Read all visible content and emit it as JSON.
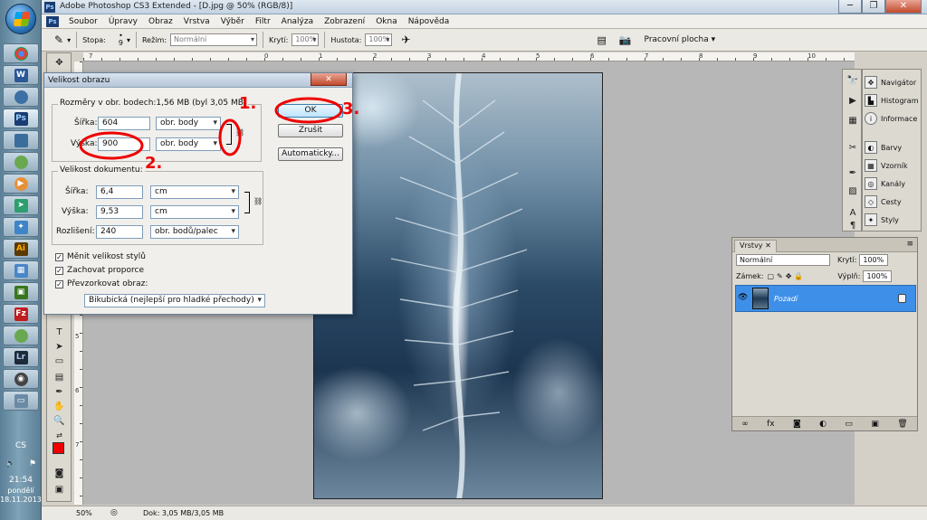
{
  "taskbar": {
    "language": "CS",
    "time": "21:54",
    "day": "pondělí",
    "date": "18.11.2013"
  },
  "window": {
    "app_logo": "Ps",
    "title": "Adobe Photoshop CS3 Extended - [D.jpg @ 50% (RGB/8)]",
    "controls": {
      "minimize": "─",
      "maximize": "❐",
      "close": "✕"
    }
  },
  "menu": [
    "Soubor",
    "Úpravy",
    "Obraz",
    "Vrstva",
    "Výběr",
    "Filtr",
    "Analýza",
    "Zobrazení",
    "Okna",
    "Nápověda"
  ],
  "options": {
    "brush_label": "Stopa:",
    "brush_size": "9",
    "mode_label": "Režim:",
    "mode_value": "Normální",
    "opacity_label": "Krytí:",
    "opacity_value": "100%",
    "flow_label": "Hustota:",
    "flow_value": "100%",
    "workspace": "Pracovní plocha ▾"
  },
  "rulers": {
    "top": [
      "7",
      "0",
      "1",
      "2",
      "3",
      "4",
      "5",
      "6",
      "7",
      "8",
      "9",
      "10",
      "11",
      "12",
      "13"
    ],
    "left": [
      "1",
      "2",
      "3",
      "4",
      "5",
      "6",
      "7",
      "8",
      "9",
      "10",
      "11",
      "12"
    ]
  },
  "dialog": {
    "title": "Velikost obrazu",
    "close": "✕",
    "pixel_dims": "Rozměry v obr. bodech:1,56 MB (byl 3,05 MB)",
    "width_label": "Šířka:",
    "width_value": "604",
    "width_unit": "obr. body",
    "height_label": "Výška:",
    "height_value": "900",
    "height_unit": "obr. body",
    "doc_size": "Velikost dokumentu:",
    "doc_width_label": "Šířka:",
    "doc_width_value": "6,4",
    "doc_width_unit": "cm",
    "doc_height_label": "Výška:",
    "doc_height_value": "9,53",
    "doc_height_unit": "cm",
    "resolution_label": "Rozlišení:",
    "resolution_value": "240",
    "resolution_unit": "obr. bodů/palec",
    "scale_styles": "Měnit velikost stylů",
    "constrain": "Zachovat proporce",
    "resample": "Převzorkovat obraz:",
    "resample_method": "Bikubická (nejlepší pro hladké přechody)",
    "ok": "OK",
    "cancel": "Zrušit",
    "auto": "Automaticky..."
  },
  "annotations": {
    "one": "1.",
    "two": "2.",
    "three": "3."
  },
  "dock": [
    "Navigátor",
    "Histogram",
    "Informace",
    "Barvy",
    "Vzorník",
    "Kanály",
    "Cesty",
    "Styly"
  ],
  "layers": {
    "tab": "Vrstvy",
    "blend": "Normální",
    "opacity_label": "Krytí:",
    "opacity_value": "100%",
    "lock_label": "Zámek:",
    "fill_label": "Výplň:",
    "fill_value": "100%",
    "layer_name": "Pozadí"
  },
  "status": {
    "zoom": "50%",
    "doc": "Dok: 3,05 MB/3,05 MB"
  }
}
